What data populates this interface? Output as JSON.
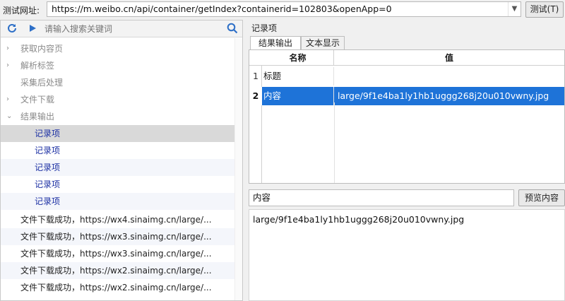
{
  "top": {
    "url_label": "测试网址:",
    "url_value": "https://m.weibo.cn/api/container/getIndex?containerid=102803&openApp=0",
    "test_button": "测试(T)"
  },
  "left": {
    "search_placeholder": "请输入搜索关键词",
    "tree": [
      {
        "label": "获取内容页",
        "chevron": "›"
      },
      {
        "label": "解析标签",
        "chevron": "›"
      },
      {
        "label": "采集后处理",
        "chevron": ""
      },
      {
        "label": "文件下载",
        "chevron": "›"
      },
      {
        "label": "结果输出",
        "chevron": "⌄"
      }
    ],
    "children": [
      "记录项",
      "记录项",
      "记录项",
      "记录项",
      "记录项"
    ],
    "logs": [
      "文件下载成功，https://wx4.sinaimg.cn/large/...",
      "文件下载成功，https://wx3.sinaimg.cn/large/...",
      "文件下载成功，https://wx3.sinaimg.cn/large/...",
      "文件下载成功，https://wx2.sinaimg.cn/large/...",
      "文件下载成功，https://wx2.sinaimg.cn/large/..."
    ]
  },
  "right": {
    "title": "记录项",
    "tabs": [
      "结果输出",
      "文本显示"
    ],
    "grid": {
      "headers": [
        "名称",
        "值"
      ],
      "rows": [
        {
          "num": "1",
          "name": "标题",
          "value": ""
        },
        {
          "num": "2",
          "name": "内容",
          "value": "large/9f1e4ba1ly1hb1uggg268j20u010vwny.jpg"
        }
      ]
    },
    "field_name": "内容",
    "preview_button": "预览内容",
    "content": "large/9f1e4ba1ly1hb1uggg268j20u010vwny.jpg"
  },
  "colors": {
    "selection": "#1e73d8",
    "tree_child": "#1b2fa3",
    "tree_grey": "#8a8a8a"
  }
}
